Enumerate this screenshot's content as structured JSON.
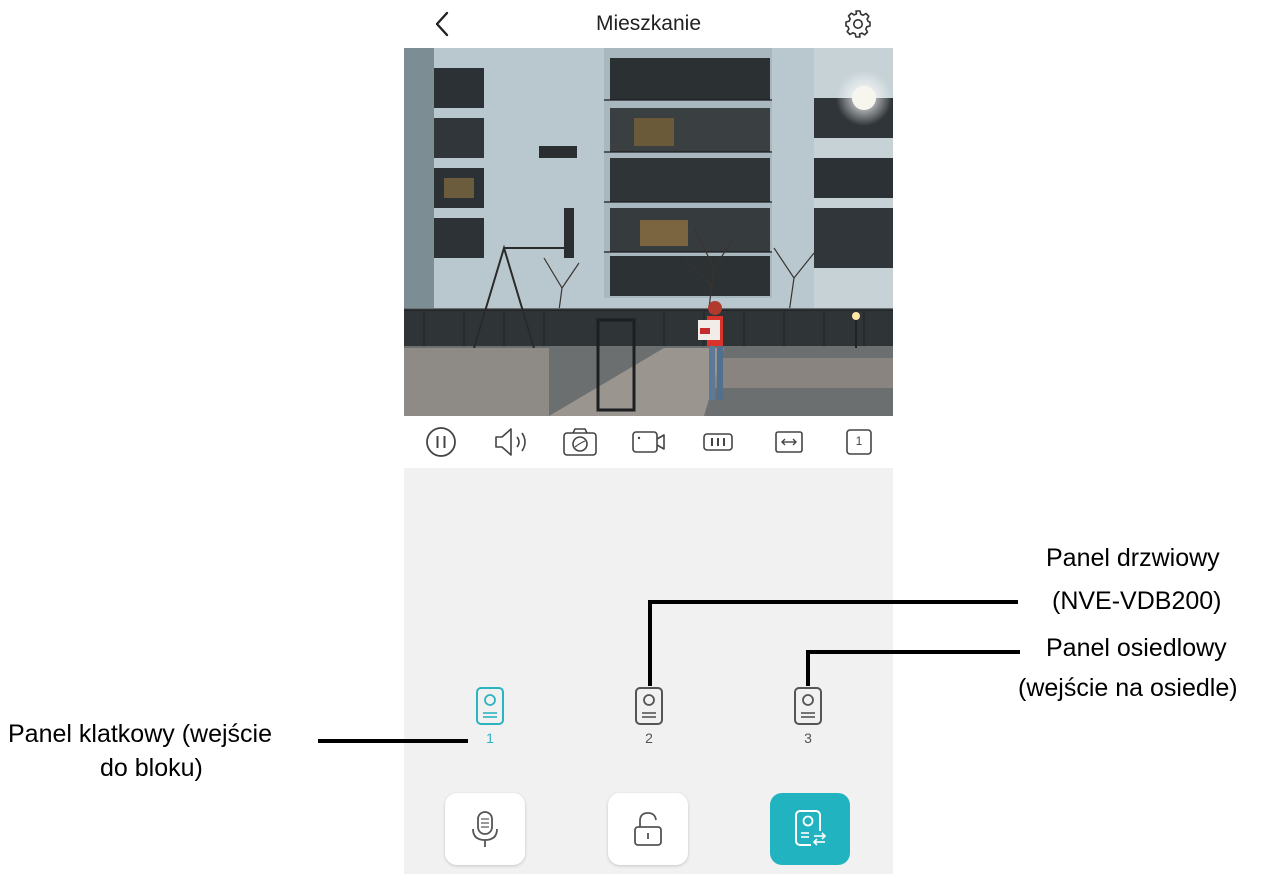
{
  "header": {
    "title": "Mieszkanie",
    "back_icon": "chevron-left-icon",
    "settings_icon": "gear-icon"
  },
  "video": {
    "description_icon": "camera-feed"
  },
  "toolbar": {
    "icons": [
      "pause-icon",
      "speaker-icon",
      "snapshot-icon",
      "record-icon",
      "quality-icon",
      "fit-screen-icon",
      "channel-one-icon"
    ],
    "channel_label": "1"
  },
  "panels": {
    "items": [
      {
        "label": "1",
        "active": true
      },
      {
        "label": "2",
        "active": false
      },
      {
        "label": "3",
        "active": false
      }
    ]
  },
  "actions": {
    "icons": [
      "microphone-icon",
      "unlock-icon",
      "switch-panel-icon"
    ]
  },
  "annotations": {
    "panel_1_line1": "Panel klatkowy (wejście",
    "panel_1_line2": "do bloku)",
    "panel_2_line1": "Panel drzwiowy",
    "panel_2_line2": "(NVE-VDB200)",
    "panel_3_line1": "Panel osiedlowy",
    "panel_3_line2": "(wejście na osiedle)"
  },
  "colors": {
    "accent": "#22b3c1",
    "panel_bg": "#f1f1f1",
    "callout": "#000000"
  }
}
